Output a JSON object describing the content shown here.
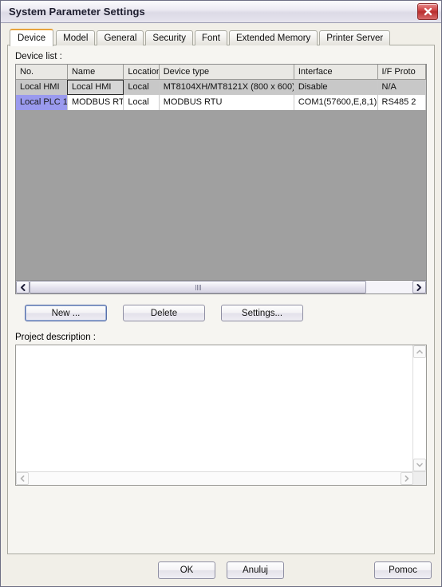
{
  "window": {
    "title": "System Parameter Settings",
    "close_label": "close-icon",
    "accent_tab_color": "#e8a33d",
    "highlight_color": "#9a9aee",
    "close_button_color": "#c13a3a"
  },
  "tabs": [
    {
      "label": "Device",
      "active": true
    },
    {
      "label": "Model",
      "active": false
    },
    {
      "label": "General",
      "active": false
    },
    {
      "label": "Security",
      "active": false
    },
    {
      "label": "Font",
      "active": false
    },
    {
      "label": "Extended Memory",
      "active": false
    },
    {
      "label": "Printer Server",
      "active": false
    }
  ],
  "device_list": {
    "label": "Device list :",
    "columns": [
      "No.",
      "Name",
      "Location",
      "Device type",
      "Interface",
      "I/F Proto"
    ],
    "rows": [
      {
        "no": "Local HMI",
        "name": "Local HMI",
        "location": "Local",
        "device_type": "MT8104XH/MT8121X (800 x 600)",
        "interface": "Disable",
        "if_protocol": "N/A",
        "selected": true,
        "name_focused": true,
        "no_highlighted": false
      },
      {
        "no": "Local PLC 1",
        "name": "MODBUS RTU",
        "location": "Local",
        "device_type": "MODBUS RTU",
        "interface": "COM1(57600,E,8,1)",
        "if_protocol": "RS485 2",
        "selected": false,
        "name_focused": false,
        "no_highlighted": true
      }
    ],
    "scroll_left_icon": "chevron-left-icon",
    "scroll_right_icon": "chevron-right-icon"
  },
  "actions": {
    "new_label": "New ...",
    "delete_label": "Delete",
    "settings_label": "Settings..."
  },
  "description": {
    "label": "Project description :",
    "value": "",
    "scroll_up_icon": "chevron-up-icon",
    "scroll_down_icon": "chevron-down-icon",
    "scroll_left_icon": "chevron-left-icon",
    "scroll_right_icon": "chevron-right-icon"
  },
  "footer": {
    "ok_label": "OK",
    "cancel_label": "Anuluj",
    "help_label": "Pomoc"
  }
}
